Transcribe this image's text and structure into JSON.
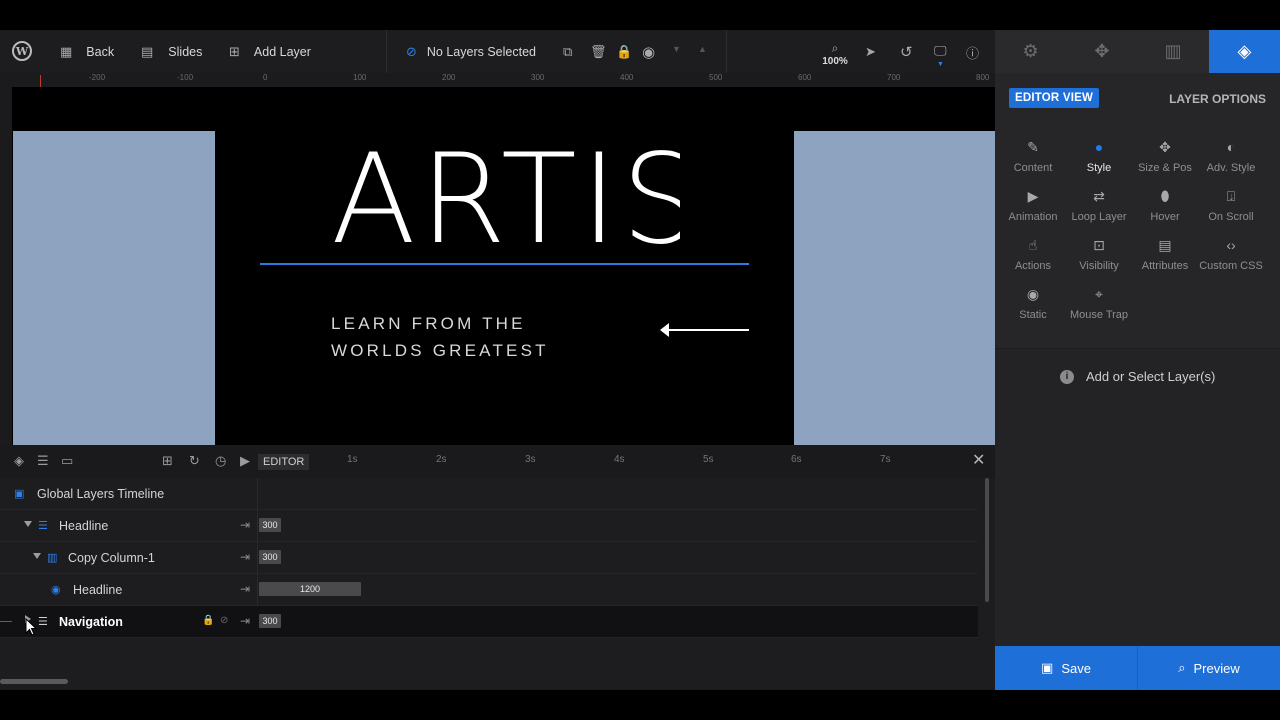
{
  "toolbar": {
    "back_label": "Back",
    "slides_label": "Slides",
    "add_layer_label": "Add Layer",
    "selection_status": "No Layers Selected",
    "zoom_level": "100%"
  },
  "ruler": {
    "top_ticks": [
      "-200",
      "-100",
      "0",
      "100",
      "200",
      "300",
      "400",
      "500",
      "600",
      "700",
      "800"
    ]
  },
  "canvas": {
    "headline": "ARTIS",
    "subtitle_line1": "LEARN FROM THE",
    "subtitle_line2": "WORLDS GREATEST"
  },
  "right_panel": {
    "editor_view_label": "EDITOR VIEW",
    "layer_options_label": "LAYER OPTIONS",
    "options": [
      {
        "label": "Content",
        "icon": "pencil-icon"
      },
      {
        "label": "Style",
        "icon": "palette-icon",
        "active": true
      },
      {
        "label": "Size & Pos",
        "icon": "move-icon"
      },
      {
        "label": "Adv. Style",
        "icon": "contrast-icon"
      },
      {
        "label": "Animation",
        "icon": "play-icon"
      },
      {
        "label": "Loop Layer",
        "icon": "loop-icon"
      },
      {
        "label": "Hover",
        "icon": "mouse-icon"
      },
      {
        "label": "On Scroll",
        "icon": "scroll-icon"
      },
      {
        "label": "Actions",
        "icon": "pointer-hand-icon"
      },
      {
        "label": "Visibility",
        "icon": "visibility-icon"
      },
      {
        "label": "Attributes",
        "icon": "file-icon"
      },
      {
        "label": "Custom CSS",
        "icon": "code-icon"
      },
      {
        "label": "Static",
        "icon": "static-icon"
      },
      {
        "label": "Mouse Trap",
        "icon": "crosshair-icon"
      }
    ],
    "empty_state": "Add or Select Layer(s)"
  },
  "savebar": {
    "save_label": "Save",
    "preview_label": "Preview"
  },
  "timeline": {
    "editor_tag": "EDITOR",
    "seconds": [
      "1s",
      "2s",
      "3s",
      "4s",
      "5s",
      "6s",
      "7s"
    ],
    "global_label": "Global Layers Timeline",
    "rows": [
      {
        "label": "Headline",
        "duration": "300"
      },
      {
        "label": "Copy Column-1",
        "duration": "300"
      },
      {
        "label": "Headline",
        "duration": "1200"
      },
      {
        "label": "Navigation",
        "duration": "300"
      }
    ]
  },
  "colors": {
    "accent": "#1f6fd9",
    "canvas_side": "#8ea3bf",
    "toolbar_bg": "#1d1d1f"
  }
}
